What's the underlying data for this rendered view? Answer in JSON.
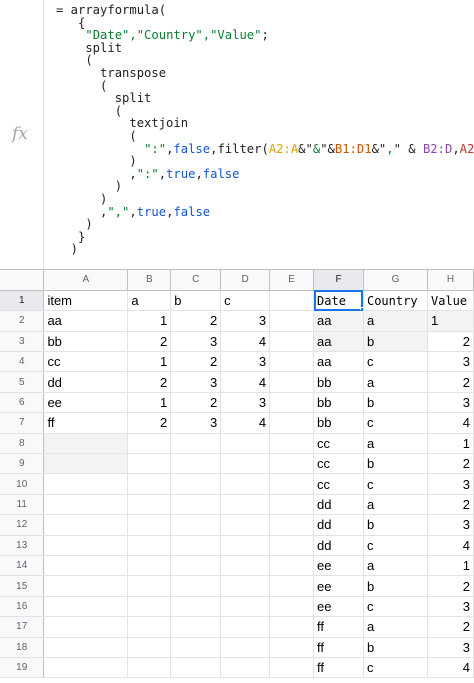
{
  "formula": {
    "fx_icon": "fx",
    "lines": [
      [
        {
          "t": "= arrayformula("
        }
      ],
      [
        {
          "t": "   {"
        }
      ],
      [
        {
          "t": "    "
        },
        {
          "t": "\"Date\",\"Country\",\"Value\"",
          "c": "str"
        },
        {
          "t": ";"
        }
      ],
      [
        {
          "t": "    split"
        }
      ],
      [
        {
          "t": "    ("
        }
      ],
      [
        {
          "t": "      transpose"
        }
      ],
      [
        {
          "t": "      ("
        }
      ],
      [
        {
          "t": "        split"
        }
      ],
      [
        {
          "t": "        ("
        }
      ],
      [
        {
          "t": "          textjoin"
        }
      ],
      [
        {
          "t": "          ("
        }
      ],
      [
        {
          "t": "            "
        },
        {
          "t": "\":\"",
          "c": "str"
        },
        {
          "t": ","
        },
        {
          "t": "false",
          "c": "kw"
        },
        {
          "t": ",filter("
        },
        {
          "t": "A2:A",
          "c": "ref1"
        },
        {
          "t": "&\""
        },
        {
          "t": "&",
          "c": "str"
        },
        {
          "t": "\"&"
        },
        {
          "t": "B1:D1",
          "c": "ref2"
        },
        {
          "t": "&\""
        },
        {
          "t": ",",
          "c": "str"
        },
        {
          "t": "\" & "
        },
        {
          "t": "B2:D",
          "c": "ref3"
        },
        {
          "t": ","
        },
        {
          "t": "A2:A",
          "c": "ref4"
        }
      ],
      [
        {
          "t": "          )"
        }
      ],
      [
        {
          "t": "          ,"
        },
        {
          "t": "\":\"",
          "c": "str"
        },
        {
          "t": ","
        },
        {
          "t": "true",
          "c": "kw"
        },
        {
          "t": ","
        },
        {
          "t": "false",
          "c": "kw"
        }
      ],
      [
        {
          "t": "        )"
        }
      ],
      [
        {
          "t": "      )"
        }
      ],
      [
        {
          "t": "      ,"
        },
        {
          "t": "\",\"",
          "c": "str"
        },
        {
          "t": ","
        },
        {
          "t": "true",
          "c": "kw"
        },
        {
          "t": ","
        },
        {
          "t": "false",
          "c": "kw"
        }
      ],
      [
        {
          "t": "    )"
        }
      ],
      [
        {
          "t": "   }"
        }
      ],
      [
        {
          "t": "  )"
        }
      ]
    ]
  },
  "grid": {
    "columns": [
      "A",
      "B",
      "C",
      "D",
      "E",
      "F",
      "G",
      "H"
    ],
    "selected_column": "F",
    "rows": [
      {
        "n": "1",
        "cells": [
          "item",
          "a",
          "b",
          "c",
          "",
          "Date",
          "Country",
          "Value"
        ]
      },
      {
        "n": "2",
        "cells": [
          "aa",
          "1",
          "2",
          "3",
          "",
          "aa",
          "a",
          "1"
        ]
      },
      {
        "n": "3",
        "cells": [
          "bb",
          "2",
          "3",
          "4",
          "",
          "aa",
          "b",
          "2"
        ]
      },
      {
        "n": "4",
        "cells": [
          "cc",
          "1",
          "2",
          "3",
          "",
          "aa",
          "c",
          "3"
        ]
      },
      {
        "n": "5",
        "cells": [
          "dd",
          "2",
          "3",
          "4",
          "",
          "bb",
          "a",
          "2"
        ]
      },
      {
        "n": "6",
        "cells": [
          "ee",
          "1",
          "2",
          "3",
          "",
          "bb",
          "b",
          "3"
        ]
      },
      {
        "n": "7",
        "cells": [
          "ff",
          "2",
          "3",
          "4",
          "",
          "bb",
          "c",
          "4"
        ]
      },
      {
        "n": "8",
        "cells": [
          "",
          "",
          "",
          "",
          "",
          "cc",
          "a",
          "1"
        ]
      },
      {
        "n": "9",
        "cells": [
          "",
          "",
          "",
          "",
          "",
          "cc",
          "b",
          "2"
        ]
      },
      {
        "n": "10",
        "cells": [
          "",
          "",
          "",
          "",
          "",
          "cc",
          "c",
          "3"
        ]
      },
      {
        "n": "11",
        "cells": [
          "",
          "",
          "",
          "",
          "",
          "dd",
          "a",
          "2"
        ]
      },
      {
        "n": "12",
        "cells": [
          "",
          "",
          "",
          "",
          "",
          "dd",
          "b",
          "3"
        ]
      },
      {
        "n": "13",
        "cells": [
          "",
          "",
          "",
          "",
          "",
          "dd",
          "c",
          "4"
        ]
      },
      {
        "n": "14",
        "cells": [
          "",
          "",
          "",
          "",
          "",
          "ee",
          "a",
          "1"
        ]
      },
      {
        "n": "15",
        "cells": [
          "",
          "",
          "",
          "",
          "",
          "ee",
          "b",
          "2"
        ]
      },
      {
        "n": "16",
        "cells": [
          "",
          "",
          "",
          "",
          "",
          "ee",
          "c",
          "3"
        ]
      },
      {
        "n": "17",
        "cells": [
          "",
          "",
          "",
          "",
          "",
          "ff",
          "a",
          "2"
        ]
      },
      {
        "n": "18",
        "cells": [
          "",
          "",
          "",
          "",
          "",
          "ff",
          "b",
          "3"
        ]
      },
      {
        "n": "19",
        "cells": [
          "",
          "",
          "",
          "",
          "",
          "ff",
          "c",
          "4"
        ]
      }
    ]
  },
  "colors": {
    "string": "#0a7d31",
    "keyword": "#1155cc",
    "selection": "#1a73e8"
  }
}
